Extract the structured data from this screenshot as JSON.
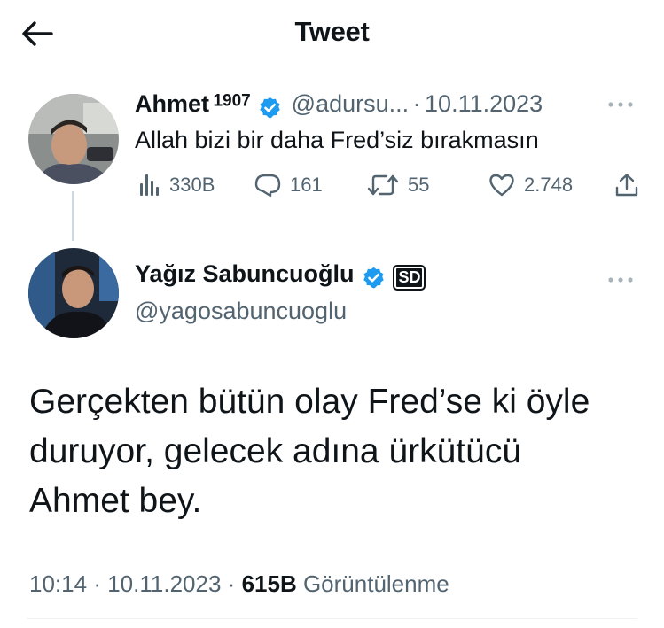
{
  "header": {
    "title": "Tweet",
    "back_icon": "arrow-left-icon"
  },
  "parent_tweet": {
    "author_name": "Ahmet",
    "author_name_sup": "1907",
    "handle": "@adursu...",
    "separator": "·",
    "date": "10.11.2023",
    "text": "Allah bizi bir daha Fred’siz bırakmasın",
    "stats": {
      "views": "330B",
      "replies": "161",
      "retweets": "55",
      "likes": "2.748"
    }
  },
  "main_tweet": {
    "author_name": "Yağız Sabuncuoğlu",
    "affiliate_badge": "SD",
    "handle": "@yagosabuncuoglu",
    "text_lines": [
      "Gerçekten bütün olay Fred’se ki öyle",
      "duruyor, gelecek adına ürkütücü",
      "Ahmet bey."
    ],
    "time": "10:14",
    "dot": "·",
    "date": "10.11.2023",
    "views_count": "615B",
    "views_label": "Görüntülenme"
  },
  "colors": {
    "verified": "#1d9bf0",
    "muted": "#536471",
    "text": "#0f1419"
  }
}
